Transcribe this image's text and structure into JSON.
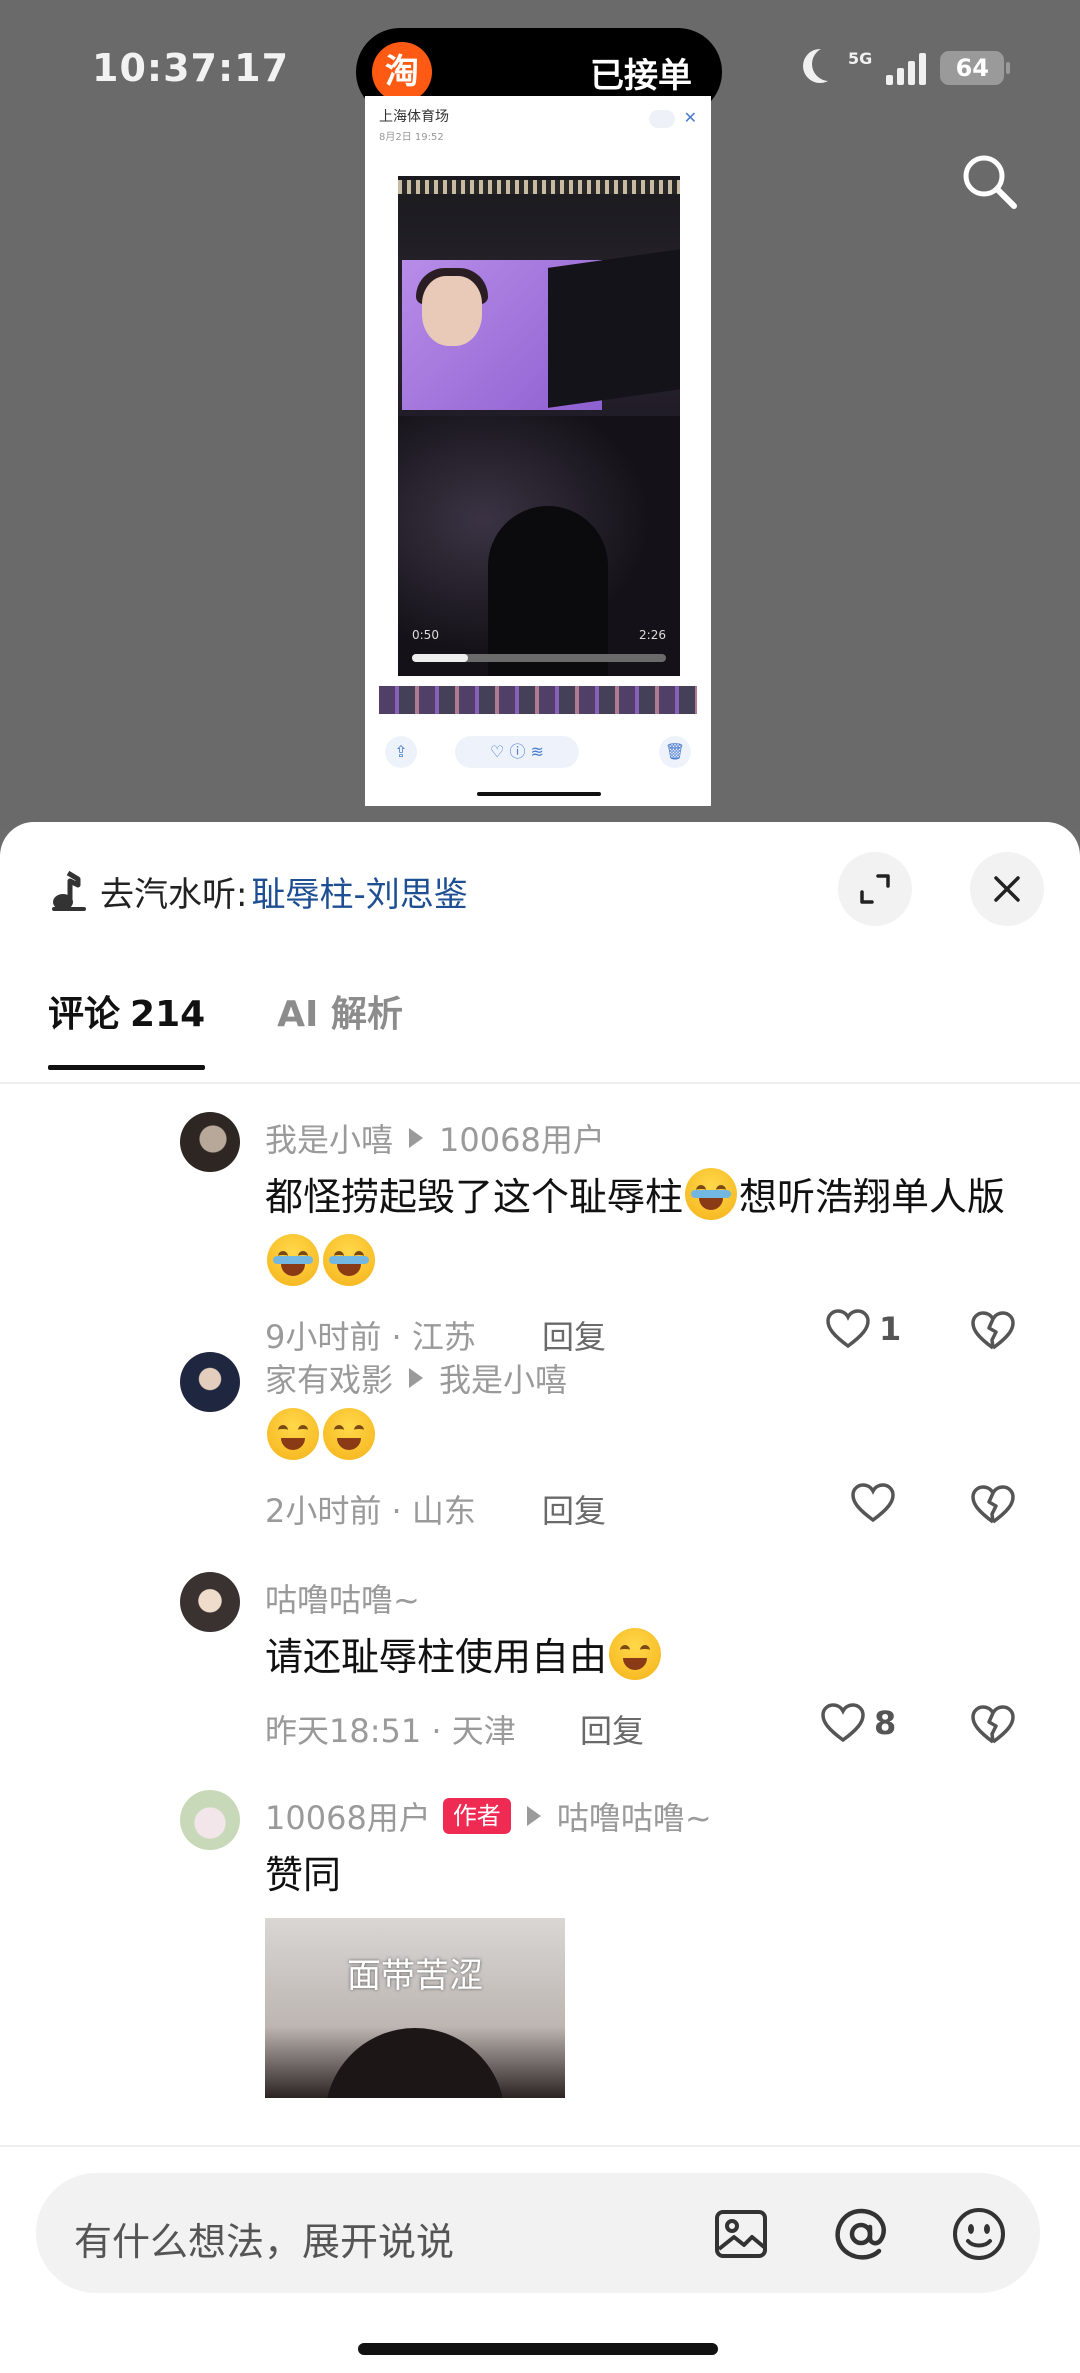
{
  "status_bar": {
    "time": "10:37:17",
    "island_app": "淘",
    "island_text": "已接单",
    "network": "5G",
    "battery": "64"
  },
  "video": {
    "screenshot_header": "上海体育场",
    "screenshot_date": "8月2日 19:52",
    "elapsed": "0:50",
    "duration": "2:26",
    "progress": 0.22
  },
  "music": {
    "prefix": "去汽水听:",
    "song": "耻辱柱-刘思鉴"
  },
  "tabs": [
    {
      "label": "评论",
      "count": "214"
    },
    {
      "label": "AI 解析"
    }
  ],
  "comments": [
    {
      "user": "我是小嘻",
      "reply_to": "10068用户",
      "text_a": "都怪捞起毁了这个耻辱柱",
      "text_b": "想听浩翔单人版",
      "time": "9小时前 · 江苏",
      "reply_label": "回复",
      "likes": "1"
    },
    {
      "user": "家有戏影",
      "reply_to": "我是小嘻",
      "time": "2小时前 · 山东",
      "reply_label": "回复",
      "likes": ""
    },
    {
      "user": "咕噜咕噜~",
      "text": "请还耻辱柱使用自由",
      "time": "昨天18:51 · 天津",
      "reply_label": "回复",
      "likes": "8"
    },
    {
      "user": "10068用户",
      "tag": "作者",
      "reply_to": "咕噜咕噜~",
      "text": "赞同",
      "sticker_caption": "面带苦涩"
    }
  ],
  "input": {
    "placeholder": "有什么想法，展开说说"
  },
  "colors": {
    "accent_link": "#1e4f93",
    "author_tag": "#f02b53",
    "taobao": "#ff5a13"
  }
}
